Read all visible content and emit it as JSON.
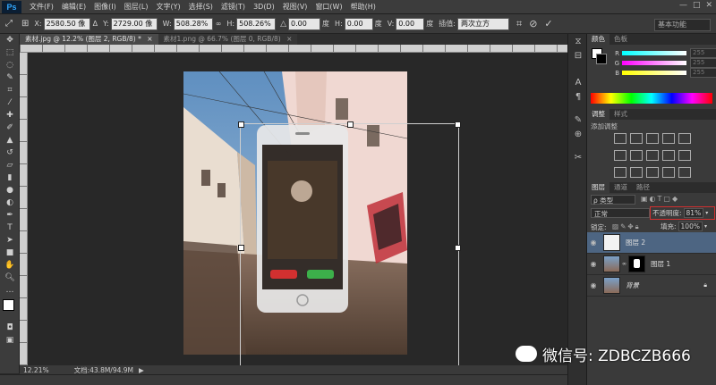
{
  "app": {
    "logo": "Ps"
  },
  "menu": [
    "文件(F)",
    "编辑(E)",
    "图像(I)",
    "图层(L)",
    "文字(Y)",
    "选择(S)",
    "滤镜(T)",
    "3D(D)",
    "视图(V)",
    "窗口(W)",
    "帮助(H)"
  ],
  "window_controls": [
    "—",
    "□",
    "✕"
  ],
  "options": {
    "x_label": "X:",
    "x_value": "2580.50 像",
    "y_label": "Y:",
    "y_value": "2729.00 像",
    "w_label": "W:",
    "w_value": "508.28%",
    "h_label": "H:",
    "h_value": "508.26%",
    "angle_value": "0.00",
    "angle_unit": "度",
    "hskew_label": "H:",
    "hskew_value": "0.00",
    "hskew_unit": "度",
    "vskew_label": "V:",
    "vskew_value": "0.00",
    "vskew_unit": "度",
    "interp_label": "插值:",
    "interp_value": "两次立方",
    "workspace": "基本功能"
  },
  "tabs": [
    {
      "label": "素材.jpg @ 12.2% (图层 2, RGB/8) *",
      "close": "×"
    },
    {
      "label": "素材1.png @ 66.7% (图层 0, RGB/8)",
      "close": "×"
    }
  ],
  "status": {
    "zoom": "12.21%",
    "doc": "文档:43.8M/94.9M"
  },
  "color_panel": {
    "tabs": [
      "颜色",
      "色板"
    ],
    "channels": [
      {
        "label": "R",
        "value": "255"
      },
      {
        "label": "G",
        "value": "255"
      },
      {
        "label": "B",
        "value": "255"
      }
    ]
  },
  "adjust_panel": {
    "tabs": [
      "调整",
      "样式"
    ],
    "title": "添加调整"
  },
  "layers_panel": {
    "tabs": [
      "图层",
      "通道",
      "路径"
    ],
    "filter_label": "ρ 类型",
    "blend_mode": "正常",
    "opacity_label": "不透明度:",
    "opacity_value": "81%",
    "lock_label": "锁定:",
    "fill_label": "填充:",
    "fill_value": "100%",
    "layers": [
      {
        "name": "图层 2"
      },
      {
        "name": "图层 1"
      },
      {
        "name": "背景"
      }
    ]
  },
  "watermark": {
    "text": "微信号: ZDBCZB666"
  },
  "colors": {
    "highlight": "#d23030",
    "selection": "#4d6582"
  }
}
